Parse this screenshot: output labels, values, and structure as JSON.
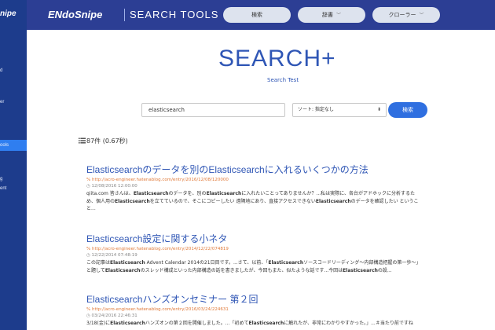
{
  "sidebar": {
    "logo": "nipe",
    "items": [
      {
        "label": "d",
        "active": false
      },
      {
        "label": "er",
        "active": false
      },
      {
        "label": "ools",
        "active": true
      },
      {
        "label": "g",
        "active": false
      },
      {
        "label": "ent",
        "active": false
      }
    ]
  },
  "header": {
    "brand": "ENdoSnipe",
    "subtitle": "SEARCH TOOLS",
    "buttons": [
      {
        "label": "検索",
        "has_dropdown": false
      },
      {
        "label": "辞書",
        "has_dropdown": true
      },
      {
        "label": "クローラー",
        "has_dropdown": true
      }
    ]
  },
  "search": {
    "logo": "SEARCH+",
    "subtitle": "Search Test",
    "query": "elasticsearch",
    "sort_value": "ソート: 指定なし",
    "button_label": "検索"
  },
  "results_summary": {
    "count_text": "87件 (0.67秒)"
  },
  "results": [
    {
      "title": "Elasticsearchのデータを別のElasticsearchに入れるいくつかの方法",
      "url": "% http://acro-engineer.hatenablog.com/entry/2016/12/08/120000",
      "date": "◷ 12/08/2016 12:00:00",
      "snippet_lines": [
        "qiita.com 皆さんは、Elasticsearchのデータを、別のElasticsearchに入れたいことってありませんか？...私は実際に、各台がアドホックに分析するた",
        "め、個人用のElasticsearchを立てているので、そこにコピーしたい 遠隔地にあり、直接アクセスできないElasticsearchのデータを確認したい というこ",
        "と..."
      ]
    },
    {
      "title": "Elasticsearch設定に関する小ネタ",
      "url": "% http://acro-engineer.hatenablog.com/entry/2014/12/22/074819",
      "date": "◷ 12/22/2014 07:48:19",
      "snippet_lines": [
        "この記事はElasticsearch Advent Calendar 2014の21日目です。...さて、以前、「Elasticsearchソースコードリーディング〜内部構造把握の第一歩〜」",
        "と題してElasticsearchのスレッド構成といった内部構造の話を書きましたが、今回もまた、似たような話です...今回はElasticsearchの設..."
      ]
    },
    {
      "title": "Elasticsearchハンズオンセミナー 第２回",
      "url": "% http://acro-engineer.hatenablog.com/entry/2016/03/24/224631",
      "date": "◷ 03/24/2016 22:46:31",
      "snippet_lines": [
        "3/18(金)にElasticsearchハンズオンの第２回を開催しました。...「初めてElasticsearchに触れたが、非常にわかりやすかった。」...＃当たり前ですね"
      ]
    }
  ]
}
